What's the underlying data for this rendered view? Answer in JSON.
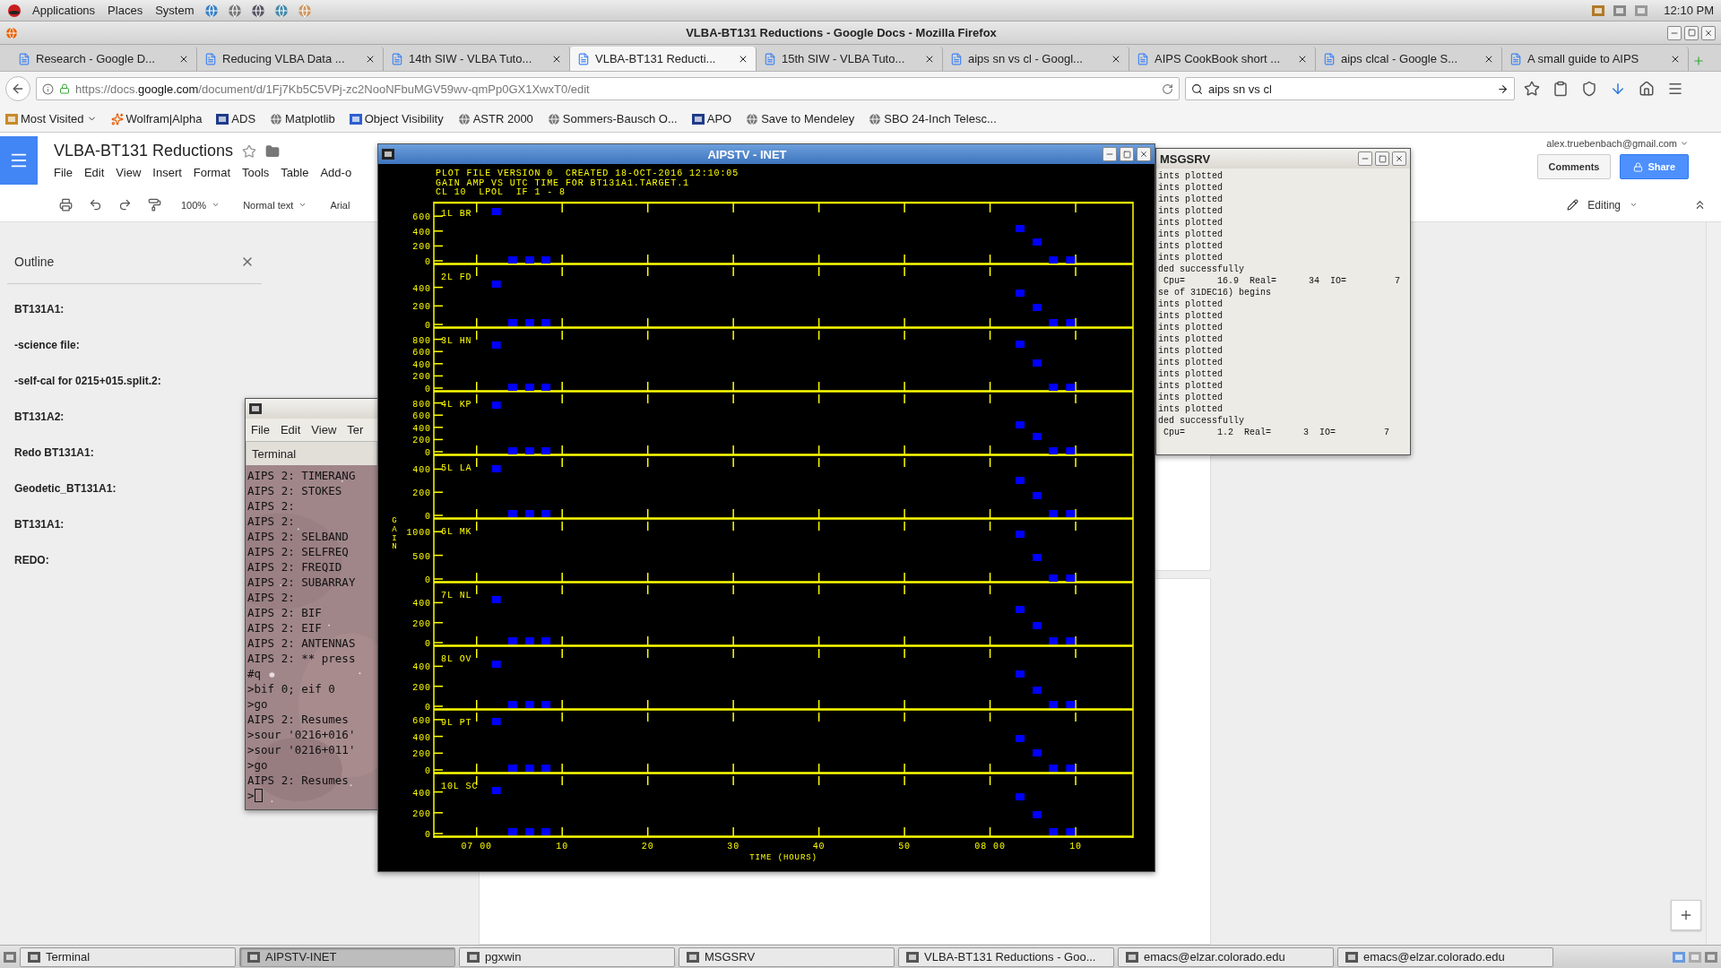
{
  "top_panel": {
    "menus": [
      "Applications",
      "Places",
      "System"
    ],
    "clock": "12:10 PM"
  },
  "browser": {
    "title": "VLBA-BT131 Reductions - Google Docs - Mozilla Firefox",
    "tabs": [
      {
        "label": "Research - Google D...",
        "selected": false
      },
      {
        "label": "Reducing VLBA Data ...",
        "selected": false
      },
      {
        "label": "14th SIW - VLBA Tuto...",
        "selected": false
      },
      {
        "label": "VLBA-BT131 Reducti...",
        "selected": true
      },
      {
        "label": "15th SIW - VLBA Tuto...",
        "selected": false
      },
      {
        "label": "aips sn vs cl - Googl...",
        "selected": false
      },
      {
        "label": "AIPS CookBook short ...",
        "selected": false
      },
      {
        "label": "aips clcal - Google S...",
        "selected": false
      },
      {
        "label": "A small guide to AIPS",
        "selected": false
      }
    ],
    "url": "https://docs.**google.com**/document/d/1Fj7Kb5C5VPj-zc2NooNFbuMGV59wv-qmPp0GX1XwxT0/edit",
    "search": "aips sn vs cl",
    "bookmarks": [
      "Most Visited",
      "Wolfram|Alpha",
      "ADS",
      "Matplotlib",
      "Object Visibility",
      "ASTR 2000",
      "Sommers-Bausch O...",
      "APO",
      "Save to Mendeley",
      "SBO 24-Inch Telesc..."
    ]
  },
  "docs": {
    "title": "VLBA-BT131 Reductions",
    "menu": [
      "File",
      "Edit",
      "View",
      "Insert",
      "Format",
      "Tools",
      "Table",
      "Add-o"
    ],
    "account": "alex.truebenbach@gmail.com",
    "comments": "Comments",
    "share": "Share",
    "zoom": "100%",
    "style": "Normal text",
    "font": "Arial",
    "mode": "Editing",
    "outline": {
      "title": "Outline",
      "items": [
        "BT131A1:",
        "-science file:",
        "-self-cal for 0215+015.split.2:",
        "BT131A2:",
        "Redo BT131A1:",
        "Geodetic_BT131A1:",
        "BT131A1:",
        "REDO:"
      ]
    }
  },
  "terminal": {
    "menu": [
      "File",
      "Edit",
      "View",
      "Ter"
    ],
    "tab": "Terminal",
    "lines": [
      "AIPS 2: TIMERANG",
      "AIPS 2: STOKES",
      "AIPS 2:",
      "AIPS 2:",
      "AIPS 2: SELBAND",
      "AIPS 2: SELFREQ",
      "AIPS 2: FREQID",
      "AIPS 2: SUBARRAY",
      "AIPS 2:",
      "AIPS 2: BIF",
      "AIPS 2: EIF",
      "AIPS 2: ANTENNAS",
      "AIPS 2: ** press",
      "#q",
      ">bif 0; eif 0",
      ">go",
      "AIPS 2: Resumes",
      ">sour '0216+016'",
      ">sour '0216+011'",
      ">go",
      "AIPS 2: Resumes",
      ">"
    ]
  },
  "aipstv": {
    "title": "AIPSTV - INET",
    "header": [
      "PLOT FILE VERSION 0  CREATED 18-OCT-2016 12:10:05",
      "GAIN AMP VS UTC TIME FOR BT131A1.TARGET.1",
      "CL 10  LPOL  IF 1 - 8"
    ],
    "ylabel": "GAIN",
    "xlabel": "TIME (HOURS)",
    "xticks": [
      "07 00",
      "10",
      "20",
      "30",
      "40",
      "50",
      "08 00",
      "10"
    ],
    "panels": [
      {
        "label": "1L BR",
        "yticks": [
          "600",
          "400",
          "200",
          "0"
        ]
      },
      {
        "label": "2L FD",
        "yticks": [
          "400",
          "200",
          "0"
        ]
      },
      {
        "label": "3L HN",
        "yticks": [
          "800",
          "600",
          "400",
          "200",
          "0"
        ]
      },
      {
        "label": "4L KP",
        "yticks": [
          "800",
          "600",
          "400",
          "200",
          "0"
        ]
      },
      {
        "label": "5L LA",
        "yticks": [
          "400",
          "200",
          "0"
        ]
      },
      {
        "label": "6L MK",
        "yticks": [
          "1000",
          "500",
          "0"
        ]
      },
      {
        "label": "7L NL",
        "yticks": [
          "400",
          "200",
          "0"
        ]
      },
      {
        "label": "8L OV",
        "yticks": [
          "400",
          "200",
          "0"
        ]
      },
      {
        "label": "9L PT",
        "yticks": [
          "600",
          "400",
          "200",
          "0"
        ]
      },
      {
        "label": "10L SC",
        "yticks": [
          "400",
          "200",
          "0"
        ]
      }
    ]
  },
  "msgsrv": {
    "title": "MSGSRV",
    "lines": [
      "ints plotted",
      "ints plotted",
      "ints plotted",
      "ints plotted",
      "ints plotted",
      "ints plotted",
      "ints plotted",
      "ints plotted",
      "ded successfully",
      " Cpu=      16.9  Real=      34  IO=         7",
      "se of 31DEC16) begins",
      "ints plotted",
      "ints plotted",
      "ints plotted",
      "ints plotted",
      "ints plotted",
      "ints plotted",
      "ints plotted",
      "ints plotted",
      "ints plotted",
      "ints plotted",
      "ded successfully",
      " Cpu=      1.2  Real=      3  IO=         7"
    ]
  },
  "taskbar": [
    {
      "label": "Terminal",
      "selected": false
    },
    {
      "label": "AIPSTV-INET",
      "selected": true
    },
    {
      "label": "pgxwin",
      "selected": false
    },
    {
      "label": "MSGSRV",
      "selected": false
    },
    {
      "label": "VLBA-BT131 Reductions - Goo...",
      "selected": false
    },
    {
      "label": "emacs@elzar.colorado.edu",
      "selected": false
    },
    {
      "label": "emacs@elzar.colorado.edu",
      "selected": false
    }
  ]
}
